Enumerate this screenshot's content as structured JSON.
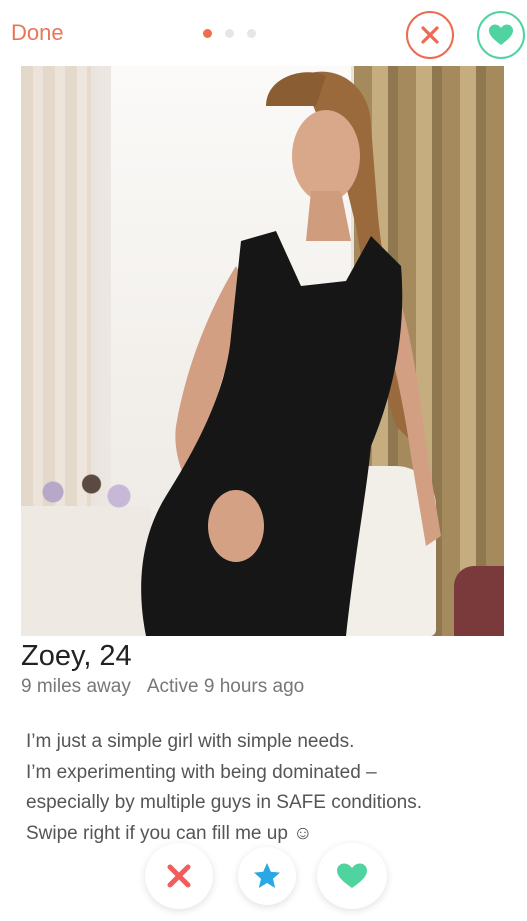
{
  "header": {
    "done_label": "Done",
    "pagination": {
      "total": 3,
      "active_index": 0
    },
    "close_icon": "close-x-icon",
    "like_icon": "heart-icon"
  },
  "profile": {
    "name_age": "Zoey, 24",
    "distance": "9 miles away",
    "active": "Active 9 hours ago",
    "bio_lines": [
      "I’m just a simple girl with simple needs.",
      "I’m experimenting with being dominated –",
      "especially by multiple guys in SAFE conditions.",
      "Swipe right if you can fill me up ☺"
    ]
  },
  "actions": {
    "nope_icon": "x-icon",
    "super_like_icon": "star-icon",
    "like_icon": "heart-icon"
  },
  "colors": {
    "accent_orange": "#ec6b51",
    "accent_green": "#4fd39f",
    "super_like_blue": "#2aa7e5",
    "active_dot": "#f26b4a",
    "inactive_dot": "#e6e6e6"
  }
}
